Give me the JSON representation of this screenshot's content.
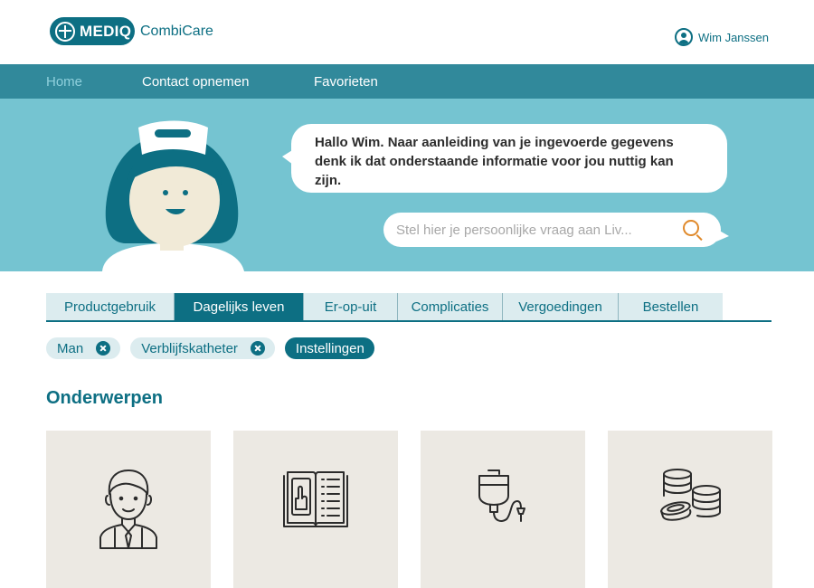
{
  "header": {
    "brand": "MEDIQ",
    "product": "CombiCare",
    "user_name": "Wim Janssen"
  },
  "nav": {
    "items": [
      {
        "label": "Home",
        "active": true
      },
      {
        "label": "Contact opnemen",
        "active": false
      },
      {
        "label": "Favorieten",
        "active": false
      }
    ]
  },
  "hero": {
    "message": "Hallo Wim. Naar aanleiding van je ingevoerde gegevens denk ik dat onderstaande informatie voor jou nuttig kan zijn.",
    "search_placeholder": "Stel hier je persoonlijke vraag aan Liv..."
  },
  "tabs": [
    {
      "label": "Productgebruik",
      "active": false
    },
    {
      "label": "Dagelijks leven",
      "active": true
    },
    {
      "label": "Er-op-uit",
      "active": false
    },
    {
      "label": "Complicaties",
      "active": false
    },
    {
      "label": "Vergoedingen",
      "active": false
    },
    {
      "label": "Bestellen",
      "active": false
    }
  ],
  "chips": [
    {
      "label": "Man",
      "removable": true,
      "selected": false
    },
    {
      "label": "Verblijfskatheter",
      "removable": true,
      "selected": false
    },
    {
      "label": "Instellingen",
      "removable": false,
      "selected": true
    }
  ],
  "section": {
    "title": "Onderwerpen"
  },
  "cards": [
    {
      "icon": "man-icon"
    },
    {
      "icon": "book-icon"
    },
    {
      "icon": "catheter-bag-icon"
    },
    {
      "icon": "coins-icon"
    }
  ],
  "colors": {
    "primary": "#0d6f83",
    "nav": "#31899b",
    "hero": "#75c4d1",
    "accent": "#e08a2c",
    "card": "#ece9e3"
  }
}
